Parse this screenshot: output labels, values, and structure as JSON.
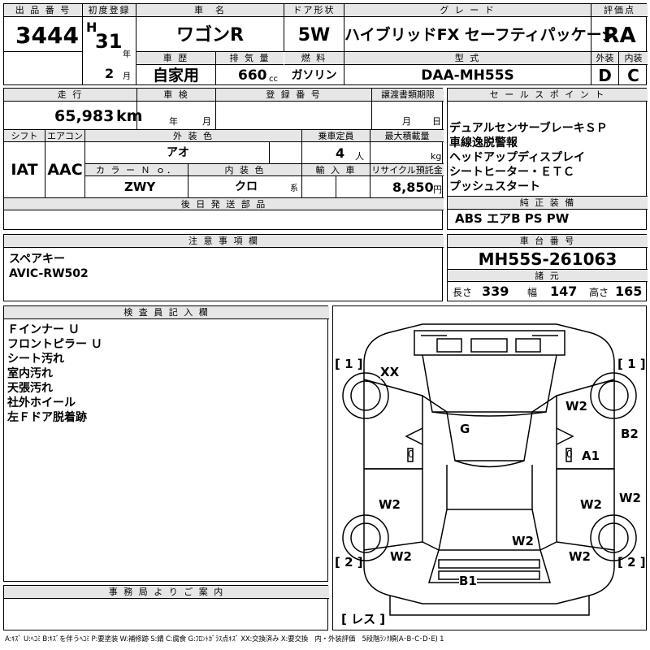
{
  "header_labels": {
    "lot_number": "出 品 番 号",
    "first_reg": "初度登録",
    "car_name": "車　名",
    "door": "ドア形状",
    "grade": "グ レ ー ド",
    "score": "評価点",
    "history": "車 歴",
    "displacement": "排 気 量",
    "fuel": "燃 料",
    "model_code": "型 式",
    "exterior": "外装",
    "interior": "内装"
  },
  "vehicle": {
    "lot_number": "3444",
    "era": "H",
    "year": "31",
    "year_unit": "年",
    "month": "2",
    "month_unit": "月",
    "car_name": "ワゴンR",
    "door": "5W",
    "grade": "ハイブリッドFX セーフティパッケージ",
    "score": "RA",
    "history": "自家用",
    "displacement": "660",
    "displacement_unit": "cc",
    "fuel": "ガソリン",
    "model_code": "DAA-MH55S",
    "exterior_grade": "D",
    "interior_grade": "C"
  },
  "row2_labels": {
    "mileage": "走 行",
    "inspection": "車 検",
    "registration": "登 録 番 号",
    "transfer_deadline": "譲渡書類期限",
    "sales_point": "セ ー ル ス ポ イ ン ト",
    "shift": "シフト",
    "aircon": "エアコン",
    "ext_color": "外 装 色",
    "capacity": "乗車定員",
    "max_load": "最大積載量",
    "color_no": "カ ラ ー Ｎ ｏ．",
    "int_color": "内 装 色",
    "import": "輸 入 車",
    "recycle": "リサイクル預託金",
    "later_parts": "後 日 発 送 部 品",
    "standard_equipment": "純 正 装 備"
  },
  "details": {
    "mileage": "65,983",
    "mileage_unit": "km",
    "inspection_year_unit": "年",
    "inspection_month_unit": "月",
    "transfer_month_unit": "月",
    "transfer_day_unit": "日",
    "shift": "IAT",
    "aircon": "AAC",
    "ext_color": "アオ",
    "capacity": "4",
    "capacity_unit": "人",
    "max_load_unit": "kg",
    "color_no": "ZWY",
    "int_color": "クロ",
    "int_color_suffix": "系",
    "recycle": "8,850",
    "recycle_unit": "円"
  },
  "sales_points": [
    "デュアルセンサーブレーキＳＰ",
    "車線逸脱警報",
    "ヘッドアップディスプレイ",
    "シートヒーター・ＥＴＣ",
    "プッシュスタート"
  ],
  "standard_equipment": "ABS エアB PS PW",
  "notes": {
    "label": "注 意 事 項 欄",
    "lines": [
      "スペアキー",
      "AVIC-RW502"
    ]
  },
  "chassis": {
    "label": "車 台 番 号",
    "number": "MH55S-261063",
    "dims_label": "諸 元",
    "length_label": "長さ",
    "length": "339",
    "width_label": "幅",
    "width": "147",
    "height_label": "高さ",
    "height": "165"
  },
  "inspector": {
    "label": "検 査 員 記 入 欄",
    "lines": [
      "Ｆインナー Ｕ",
      "フロントピラー Ｕ",
      "シート汚れ",
      "室内汚れ",
      "天張汚れ",
      "社外ホイール",
      "左Ｆドア脱着跡"
    ]
  },
  "office": {
    "label": "事 務 局 よ り ご 案 内"
  },
  "diagram": {
    "bracket_1_left": "[ 1 ]",
    "bracket_1_right": "[ 1 ]",
    "bracket_2_left": "[ 2 ]",
    "bracket_2_right": "[ 2 ]",
    "bracket_res": "[ レス ]",
    "marks": [
      "XX",
      "G",
      "W2",
      "B2",
      "A1",
      "W2",
      "W2",
      "W2",
      "W2",
      "W2",
      "W2",
      "W2",
      "B1"
    ],
    "zero": "0"
  },
  "legend": "A:ｷｽﾞ U:ﾍｺﾐ B:ｷｽﾞを伴うﾍｺﾐ P:要塗装 W:補修跡 S:錆 C:腐食 G:ﾌﾛﾝﾄｶﾞﾗｽ点ｷｽﾞ XX:交換済み X:要交換　内・外装評価　5段階ﾗﾝｸ順(A･B･C･D･E) 1"
}
